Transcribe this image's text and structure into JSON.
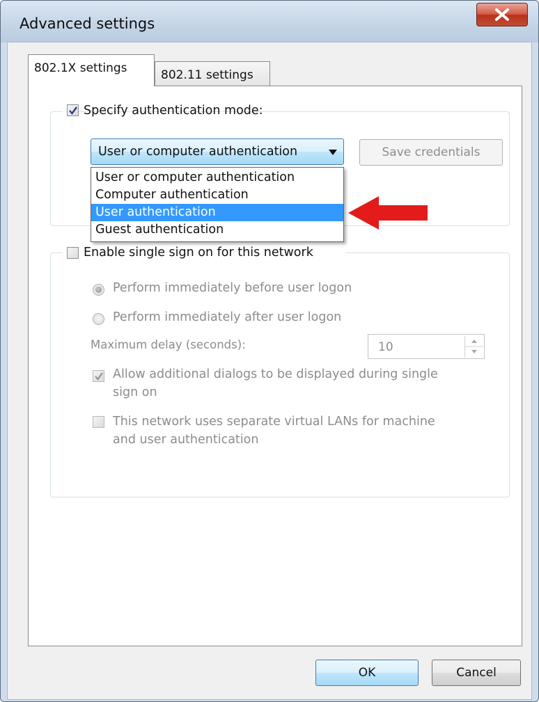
{
  "window": {
    "title": "Advanced settings"
  },
  "tabs": [
    {
      "label": "802.1X settings",
      "active": true
    },
    {
      "label": "802.11 settings",
      "active": false
    }
  ],
  "auth": {
    "specify_label": "Specify authentication mode:",
    "specify_checked": true,
    "selected_value": "User or computer authentication",
    "save_credentials_label": "Save credentials",
    "options": [
      "User or computer authentication",
      "Computer authentication",
      "User authentication",
      "Guest authentication"
    ],
    "highlighted_option": "User authentication"
  },
  "sso": {
    "enable_label": "Enable single sign on for this network",
    "enable_checked": false,
    "radio_before": "Perform immediately before user logon",
    "radio_after": "Perform immediately after user logon",
    "delay_label": "Maximum delay (seconds):",
    "delay_value": "10",
    "allow_dialogs_line1": "Allow additional dialogs to be displayed during single",
    "allow_dialogs_line2": "sign on",
    "allow_dialogs_checked": true,
    "vlan_line1": "This network uses separate virtual LANs for machine",
    "vlan_line2": "and user authentication",
    "vlan_checked": false
  },
  "buttons": {
    "ok": "OK",
    "cancel": "Cancel"
  },
  "colors": {
    "selection": "#3399ff",
    "arrow": "#e31b1b",
    "close_button": "#c44a33"
  }
}
